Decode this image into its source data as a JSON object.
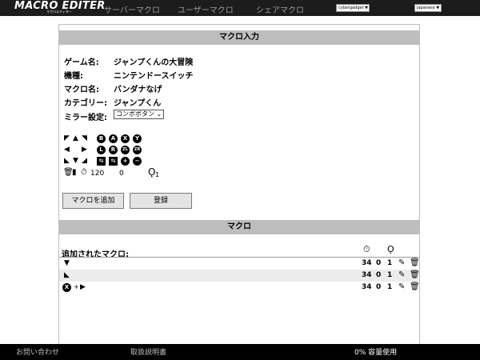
{
  "header": {
    "logo_text": "MACRO EDITER",
    "logo_sub": "マクロエディター",
    "nav": [
      "サーバーマクロ",
      "ユーザーマクロ",
      "シェアマクロ"
    ],
    "account_select": "cybergadget",
    "language_select": "Japanese"
  },
  "input_section": {
    "title": "マクロ入力",
    "game_label": "ゲーム名:",
    "game_value": "ジャンプくんの大冒険",
    "device_label": "機種:",
    "device_value": "ニンテンドースイッチ",
    "macro_label": "マクロ名:",
    "macro_value": "バンダナなげ",
    "category_label": "カテゴリー:",
    "category_value": "ジャンプくん",
    "mirror_label": "ミラー設定:",
    "mirror_value": "コンボボタン",
    "buttons": {
      "b": "B",
      "a": "A",
      "x": "X",
      "y": "Y",
      "l": "L",
      "r": "R",
      "zl": "ZL",
      "zr": "ZR",
      "plus": "+",
      "minus": "−"
    },
    "timer_value": "120",
    "zero_value": "0",
    "repeat_value": "1",
    "add_button": "マクロを追加",
    "register_button": "登録"
  },
  "macro_section": {
    "title": "マクロ",
    "list_title": "追加されたマクロ:",
    "rows": [
      {
        "time": "34",
        "z": "0",
        "repeat": "1"
      },
      {
        "time": "34",
        "z": "0",
        "repeat": "1"
      },
      {
        "time": "34",
        "z": "0",
        "repeat": "1"
      }
    ],
    "row3_plus": "+"
  },
  "footer": {
    "contact": "お問い合わせ",
    "manual": "取扱説明書",
    "usage": "0% 容量使用"
  }
}
